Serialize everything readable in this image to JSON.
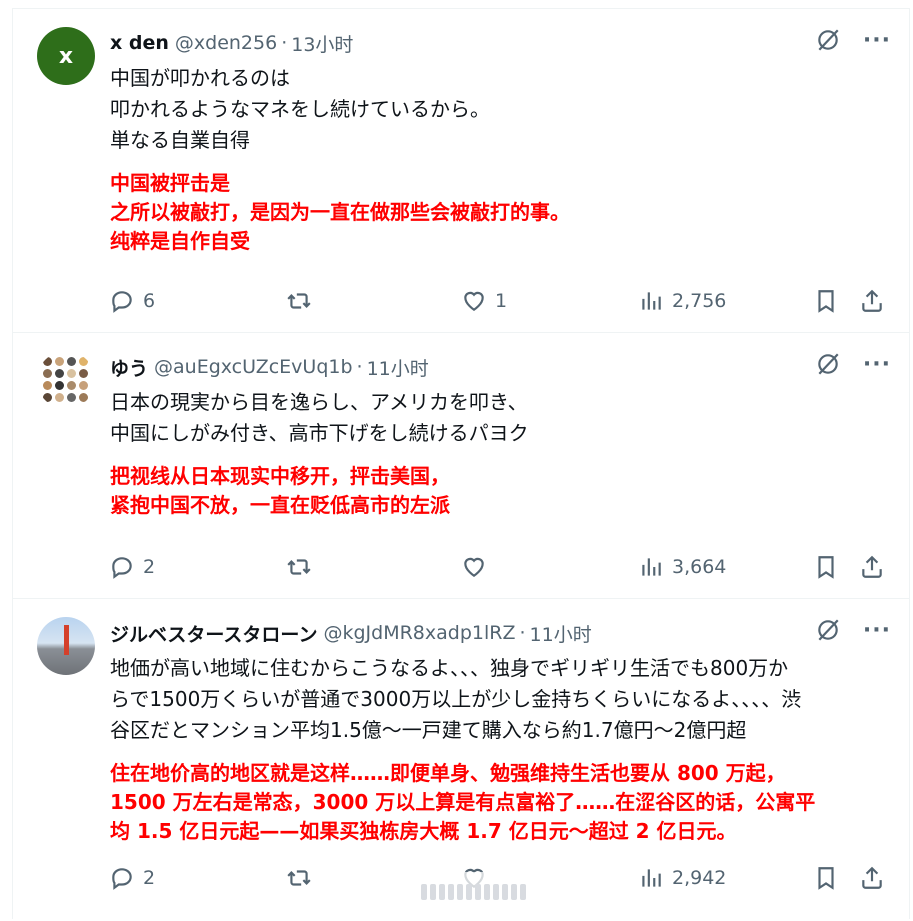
{
  "tweets": [
    {
      "avatar_letter": "x",
      "name": "x den",
      "handle": "@xden256",
      "sep": "·",
      "time": "13小时",
      "text_jp": "中国が叩かれるのは\n叩かれるようなマネをし続けているから。\n単なる自業自得",
      "text_cn": "中国被抨击是\n之所以被敲打，是因为一直在做那些会被敲打的事。\n纯粹是自作自受",
      "replies": "6",
      "reposts": "",
      "likes": "1",
      "views": "2,756"
    },
    {
      "name": "ゆう",
      "handle": "@auEgxcUZcEvUq1b",
      "sep": "·",
      "time": "11小时",
      "text_jp": "日本の現実から目を逸らし、アメリカを叩き、\n中国にしがみ付き、高市下げをし続けるパヨク",
      "text_cn": "把视线从日本现实中移开，抨击美国，\n紧抱中国不放，一直在贬低高市的左派",
      "replies": "2",
      "reposts": "",
      "likes": "",
      "views": "3,664"
    },
    {
      "name": "ジルベスタースタローン",
      "handle": "@kgJdMR8xadp1lRZ",
      "sep": "·",
      "time": "11小时",
      "text_jp": "地価が高い地域に住むからこうなるよ、、、独身でギリギリ生活でも800万か\nらで1500万くらいが普通で3000万以上が少し金持ちくらいになるよ、、、、渋\n谷区だとマンション平均1.5億〜一戸建て購入なら約1.7億円〜2億円超",
      "text_cn": "住在地价高的地区就是这样……即便单身、勉强维持生活也要从 800 万起，\n1500 万左右是常态，3000 万以上算是有点富裕了……在涩谷区的话，公寓平\n均 1.5 亿日元起——如果买独栋房大概 1.7 亿日元〜超过 2 亿日元。",
      "replies": "2",
      "reposts": "",
      "likes": "",
      "views": "2,942"
    }
  ],
  "icons": {
    "reply": "reply-icon",
    "repost": "repost-icon",
    "like": "heart-icon",
    "views": "views-icon",
    "bookmark": "bookmark-icon",
    "share": "share-icon",
    "grok": "grok-icon",
    "more": "more-icon"
  },
  "more_glyph": "···",
  "colors": {
    "translation_text": "#ff0000",
    "secondary_text": "#536471",
    "avatar_green": "#2e6e1a"
  }
}
